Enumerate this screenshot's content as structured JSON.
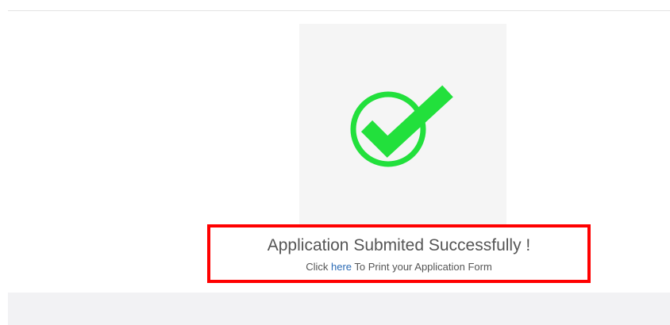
{
  "success": {
    "title": "Application Submited Successfully !",
    "prefix": "Click",
    "link_text": "here",
    "suffix": "To Print your Application Form"
  },
  "icons": {
    "success": "check-circle-icon"
  },
  "colors": {
    "check_green": "#22e03c",
    "highlight_border": "#ff0000",
    "link_blue": "#2a6ab5",
    "card_background": "#f5f5f5"
  }
}
